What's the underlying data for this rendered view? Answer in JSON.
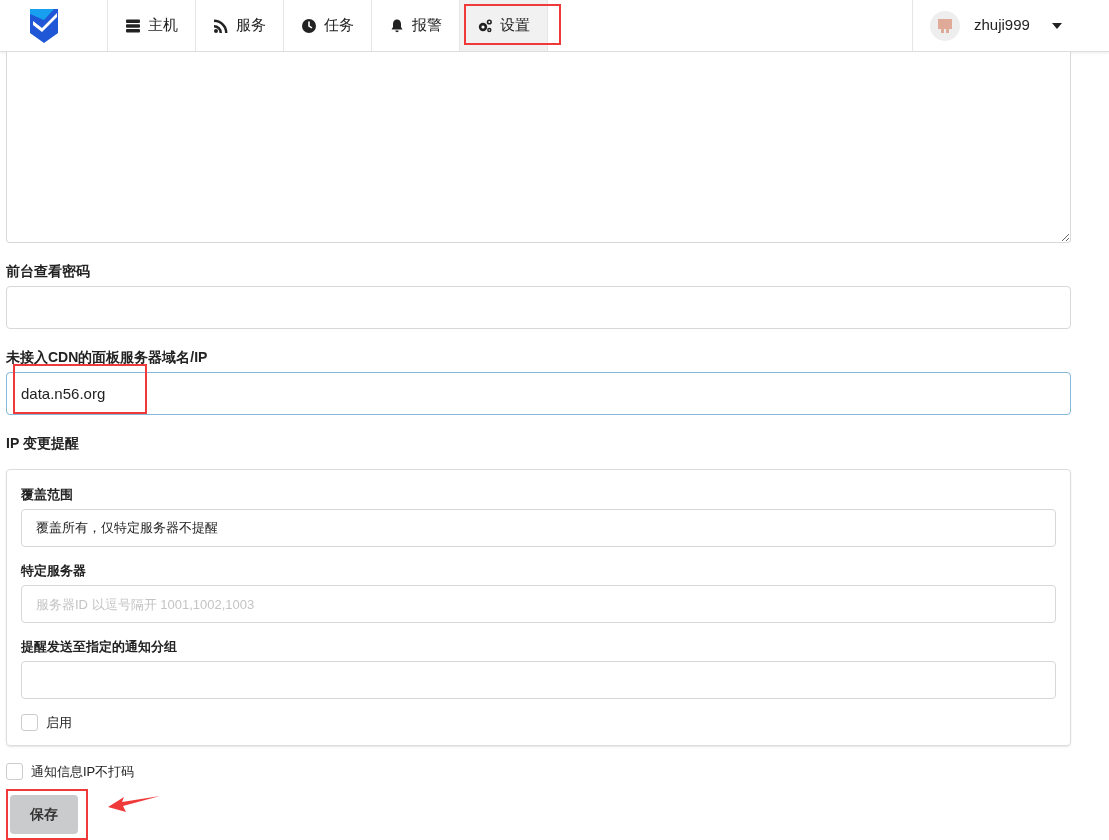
{
  "navbar": {
    "items": [
      {
        "label": "主机",
        "selected": false,
        "highlighted": false
      },
      {
        "label": "服务",
        "selected": false,
        "highlighted": false
      },
      {
        "label": "任务",
        "selected": false,
        "highlighted": false
      },
      {
        "label": "报警",
        "selected": false,
        "highlighted": false
      },
      {
        "label": "设置",
        "selected": true,
        "highlighted": true
      }
    ],
    "user": {
      "name": "zhuji999"
    }
  },
  "fields": [
    {
      "kind": "textarea",
      "focused": false,
      "highlighted": false
    },
    {
      "kind": "input",
      "label": "前台查看密码",
      "focused": false,
      "highlighted": false
    },
    {
      "kind": "input",
      "label": "未接入CDN的面板服务器域名/IP",
      "value": "data.n56.org",
      "focused": true,
      "highlighted": true
    }
  ],
  "ip_change_alert": {
    "title": "IP 变更提醒",
    "controls": [
      {
        "kind": "select",
        "label": "覆盖范围",
        "value": "覆盖所有，仅特定服务器不提醒"
      },
      {
        "kind": "input",
        "label": "特定服务器",
        "placeholder": "服务器ID 以逗号隔开 1001,1002,1003"
      },
      {
        "kind": "input",
        "label": "提醒发送至指定的通知分组"
      },
      {
        "kind": "checkbox",
        "label": "启用",
        "checked": false
      }
    ]
  },
  "mask_ip": {
    "label": "通知信息IP不打码",
    "checked": false
  },
  "save_button": {
    "label": "保存",
    "highlighted": true,
    "arrow": true
  }
}
